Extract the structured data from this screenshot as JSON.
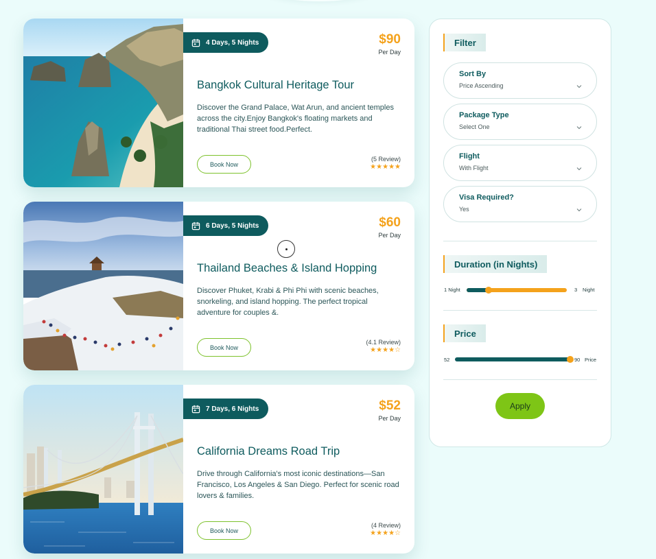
{
  "tours": [
    {
      "duration": "4 Days, 5 Nights",
      "price": "$90",
      "price_unit": "Per Day",
      "title": "Bangkok Cultural Heritage Tour",
      "description": "Discover the Grand Palace, Wat Arun, and ancient temples across the city.Enjoy Bangkok's floating markets and traditional Thai street food.Perfect.",
      "button": "Book Now",
      "review_text": "(5 Review)",
      "stars": "★★★★★"
    },
    {
      "duration": "6 Days, 5 Nights",
      "price": "$60",
      "price_unit": "Per Day",
      "title": "Thailand Beaches & Island Hopping",
      "description": "Discover Phuket, Krabi & Phi Phi with scenic beaches, snorkeling, and island hopping. The perfect tropical adventure for couples &.",
      "button": "Book Now",
      "review_text": "(4.1 Review)",
      "stars": "★★★★☆"
    },
    {
      "duration": "7 Days, 6 Nights",
      "price": "$52",
      "price_unit": "Per Day",
      "title": "California Dreams Road Trip",
      "description": "Drive through California's most iconic destinations—San Francisco, Los Angeles & San Diego. Perfect for scenic road lovers & families.",
      "button": "Book Now",
      "review_text": "(4 Review)",
      "stars": "★★★★☆"
    }
  ],
  "filter": {
    "title": "Filter",
    "selects": [
      {
        "label": "Sort By",
        "value": "Price Ascending"
      },
      {
        "label": "Package Type",
        "value": "Select One"
      },
      {
        "label": "Flight",
        "value": "With Flight"
      },
      {
        "label": "Visa Required?",
        "value": "Yes"
      }
    ],
    "duration": {
      "title": "Duration (in Nights)",
      "min_label": "1 Night",
      "max_value": "3",
      "max_unit": "Night",
      "selected_from_fraction": 0.22
    },
    "price": {
      "title": "Price",
      "min_label": "52",
      "max_value": "90",
      "max_unit": "Price",
      "selected_fraction": 1.0
    },
    "apply_label": "Apply"
  },
  "colors": {
    "teal": "#0e5b5e",
    "orange": "#f4a21c",
    "green": "#7ec516"
  }
}
